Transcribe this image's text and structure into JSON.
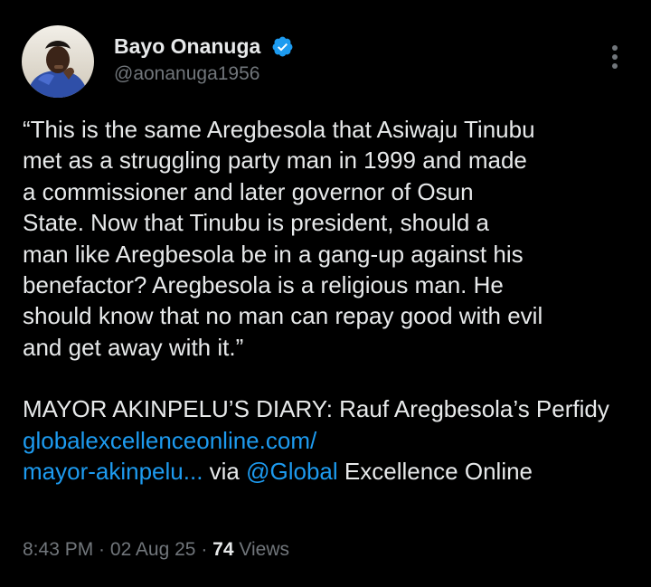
{
  "author": {
    "display_name": "Bayo Onanuga",
    "handle": "@aonanuga1956",
    "verified_icon": "verified-badge-icon",
    "avatar": "profile-photo"
  },
  "more_icon": "more-options-icon",
  "tweet": {
    "quote_text": "“This is the same Aregbesola that Asiwaju Tinubu\nmet as a struggling party man in 1999 and made\na commissioner and later governor of Osun\nState. Now that Tinubu is president, should a\nman like Aregbesola be in a gang-up against his\nbenefactor? Aregbesola is a religious man. He\nshould know that no man can repay good with evil\nand get away with it.”",
    "diary_prefix": "MAYOR AKINPELU’S DIARY: Rauf Aregbesola’s Perfidy ",
    "link_line1": "globalexcellenceonline.com/",
    "link_line2": "mayor-akinpelu...",
    "via": " via ",
    "mention": "@Global",
    "suffix": " Excellence Online"
  },
  "meta": {
    "time": "8:43 PM",
    "separator": " · ",
    "date": "02 Aug 25",
    "views_count": "74",
    "views_label": " Views"
  },
  "colors": {
    "background": "#000000",
    "text": "#e7e9ea",
    "secondary": "#71767b",
    "link": "#1d9bf0"
  }
}
